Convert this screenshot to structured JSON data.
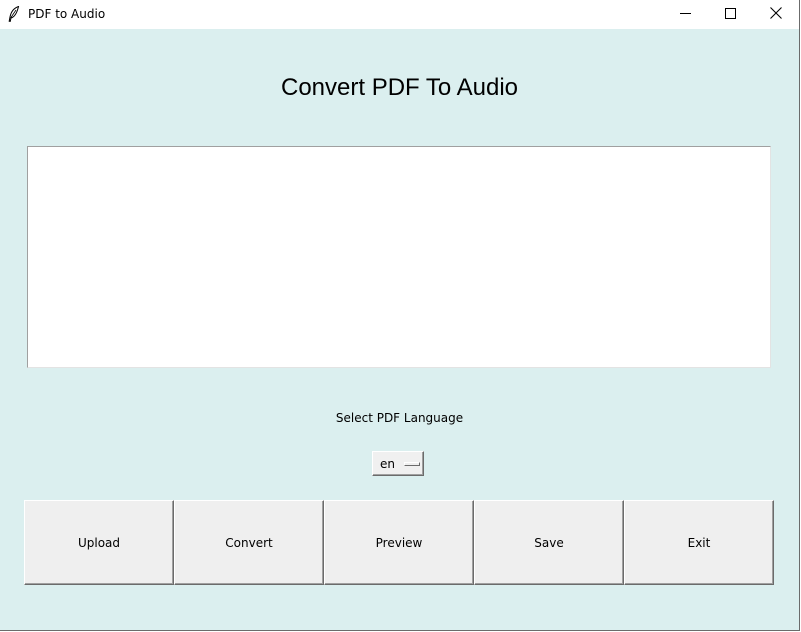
{
  "window": {
    "title": "PDF to Audio",
    "controls": {
      "minimize": "minimize-icon",
      "maximize": "maximize-icon",
      "close": "close-icon"
    }
  },
  "main": {
    "heading": "Convert PDF To Audio",
    "text_area_value": "",
    "language_label": "Select PDF Language",
    "language_selected": "en"
  },
  "buttons": {
    "upload": "Upload",
    "convert": "Convert",
    "preview": "Preview",
    "save": "Save",
    "exit": "Exit"
  },
  "colors": {
    "background": "#dbefef",
    "button_face": "#efefef",
    "titlebar": "#ffffff"
  }
}
